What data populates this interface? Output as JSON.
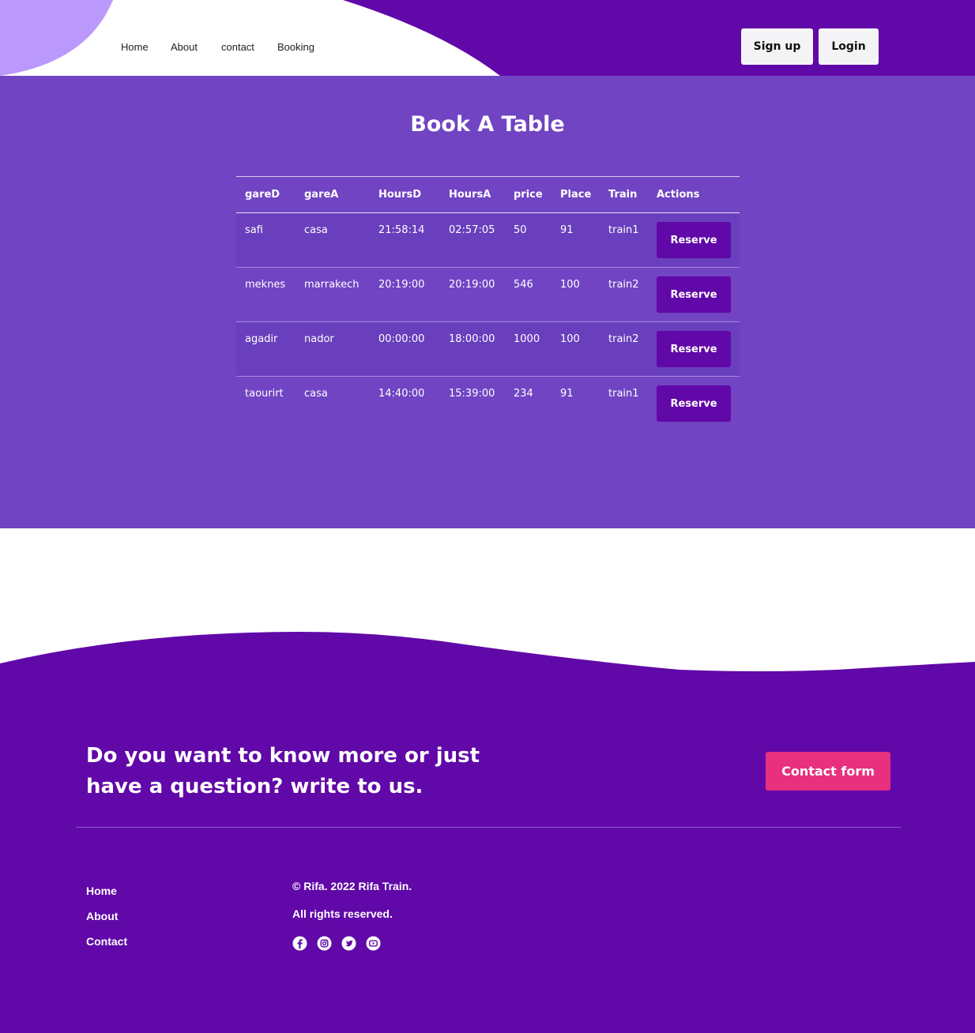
{
  "nav": {
    "items": [
      "Home",
      "About",
      "contact",
      "Booking"
    ],
    "signup_label": "Sign up",
    "login_label": "Login"
  },
  "booking": {
    "title": "Book A Table",
    "columns": [
      "gareD",
      "gareA",
      "HoursD",
      "HoursA",
      "price",
      "Place",
      "Train",
      "Actions"
    ],
    "rows": [
      {
        "gareD": "safi",
        "gareA": "casa",
        "hoursD": "21:58:14",
        "hoursA": "02:57:05",
        "price": "50",
        "place": "91",
        "train": "train1",
        "action": "Reserve"
      },
      {
        "gareD": "meknes",
        "gareA": "marrakech",
        "hoursD": "20:19:00",
        "hoursA": "20:19:00",
        "price": "546",
        "place": "100",
        "train": "train2",
        "action": "Reserve"
      },
      {
        "gareD": "agadir",
        "gareA": "nador",
        "hoursD": "00:00:00",
        "hoursA": "18:00:00",
        "price": "1000",
        "place": "100",
        "train": "train2",
        "action": "Reserve"
      },
      {
        "gareD": "taourirt",
        "gareA": "casa",
        "hoursD": "14:40:00",
        "hoursA": "15:39:00",
        "price": "234",
        "place": "91",
        "train": "train1",
        "action": "Reserve"
      }
    ]
  },
  "footer": {
    "cta_line1": "Do you want to know more or just",
    "cta_line2": "have a question? write to us.",
    "contact_button": "Contact form",
    "links": [
      "Home",
      "About",
      "Contact"
    ],
    "copyright": "© Rifa. 2022 Rifa Train.",
    "rights": "All rights reserved.",
    "socials": [
      "facebook-icon",
      "instagram-icon",
      "twitter-icon",
      "youtube-icon"
    ]
  },
  "colors": {
    "brand_purple": "#6108a8",
    "section_purple": "#7144c3",
    "light_purple": "#bb98fc",
    "accent_pink": "#e8307e"
  }
}
